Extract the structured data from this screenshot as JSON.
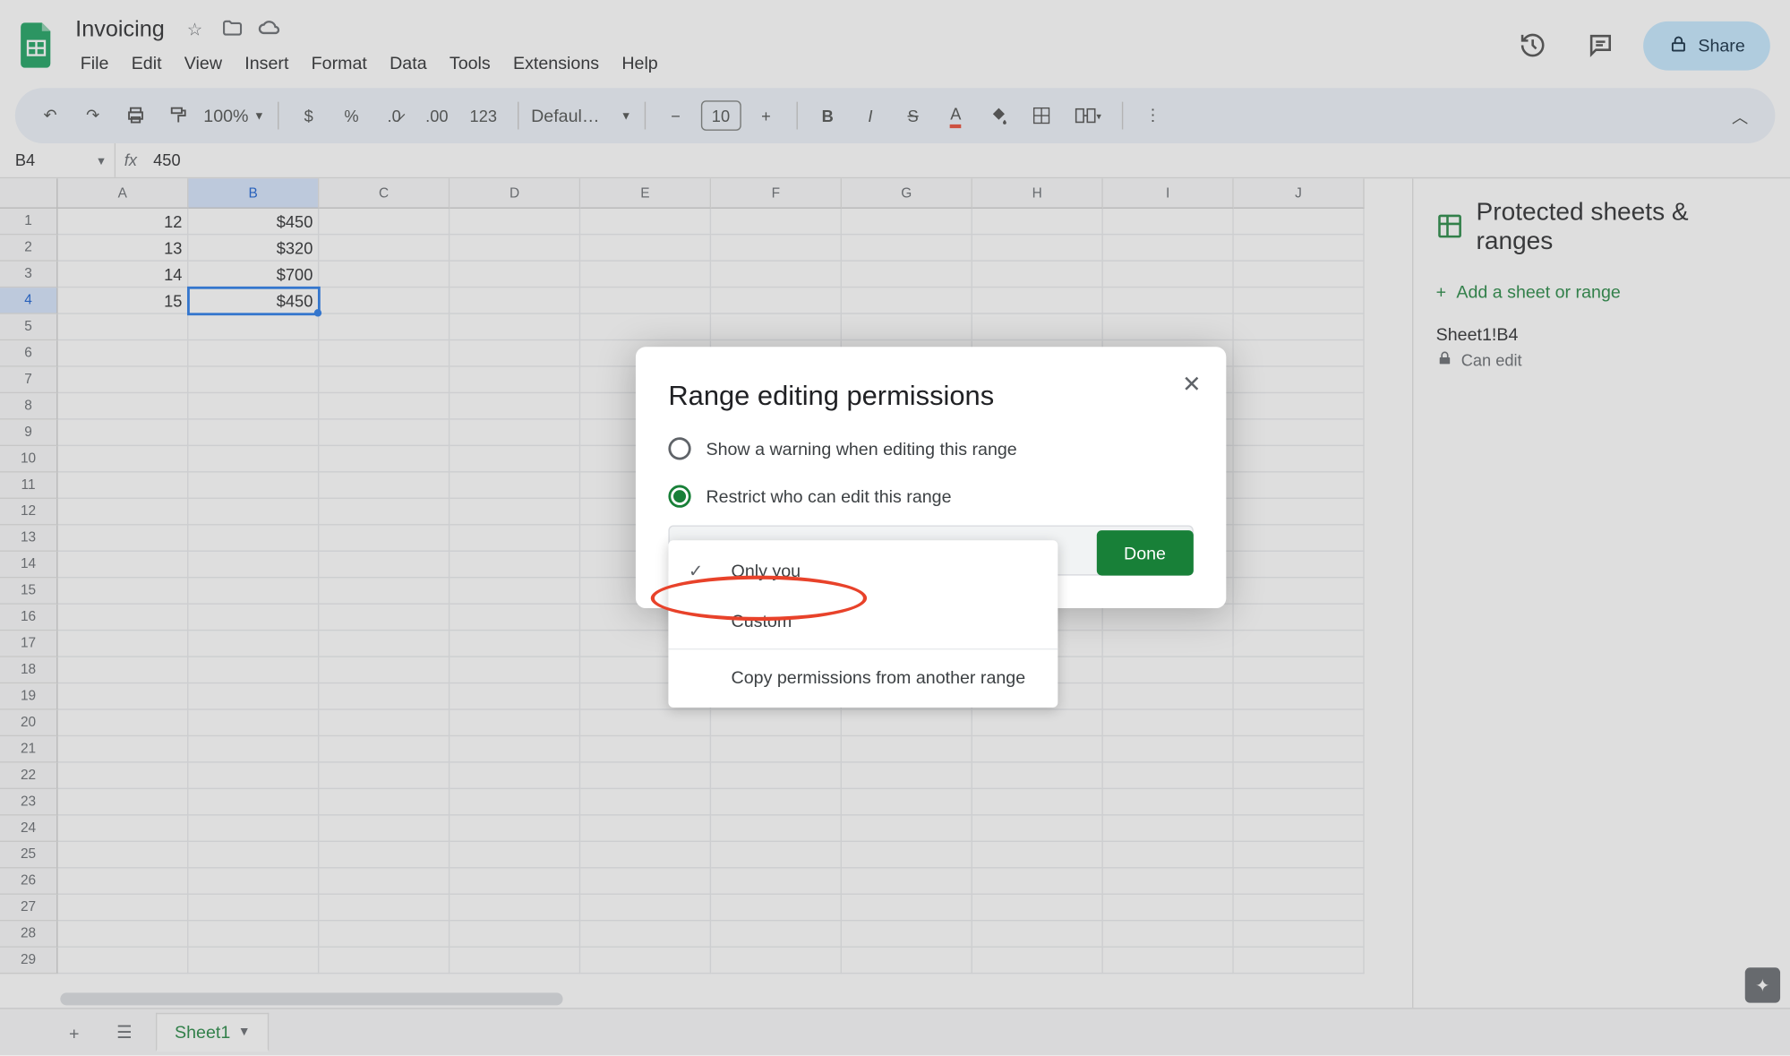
{
  "doc": {
    "title": "Invoicing"
  },
  "menus": [
    "File",
    "Edit",
    "View",
    "Insert",
    "Format",
    "Data",
    "Tools",
    "Extensions",
    "Help"
  ],
  "share_label": "Share",
  "toolbar": {
    "zoom": "100%",
    "font": "Defaul…",
    "fontsize": "10",
    "numfmt_123": "123"
  },
  "formula": {
    "cell": "B4",
    "value": "450"
  },
  "columns": [
    "A",
    "B",
    "C",
    "D",
    "E",
    "F",
    "G",
    "H",
    "I",
    "J"
  ],
  "rows": 29,
  "selected": {
    "col": "B",
    "row": 4
  },
  "cells": {
    "A1": "12",
    "B1": "$450",
    "A2": "13",
    "B2": "$320",
    "A3": "14",
    "B3": "$700",
    "A4": "15",
    "B4": "$450"
  },
  "sidepanel": {
    "title": "Protected sheets & ranges",
    "add": "Add a sheet or range",
    "range": "Sheet1!B4",
    "permission": "Can edit"
  },
  "sheets": {
    "tab1": "Sheet1"
  },
  "dialog": {
    "title": "Range editing permissions",
    "opt_warn": "Show a warning when editing this range",
    "opt_restrict": "Restrict who can edit this range",
    "dd_only_you": "Only you",
    "dd_custom": "Custom",
    "dd_copy": "Copy permissions from another range",
    "done": "Done"
  }
}
